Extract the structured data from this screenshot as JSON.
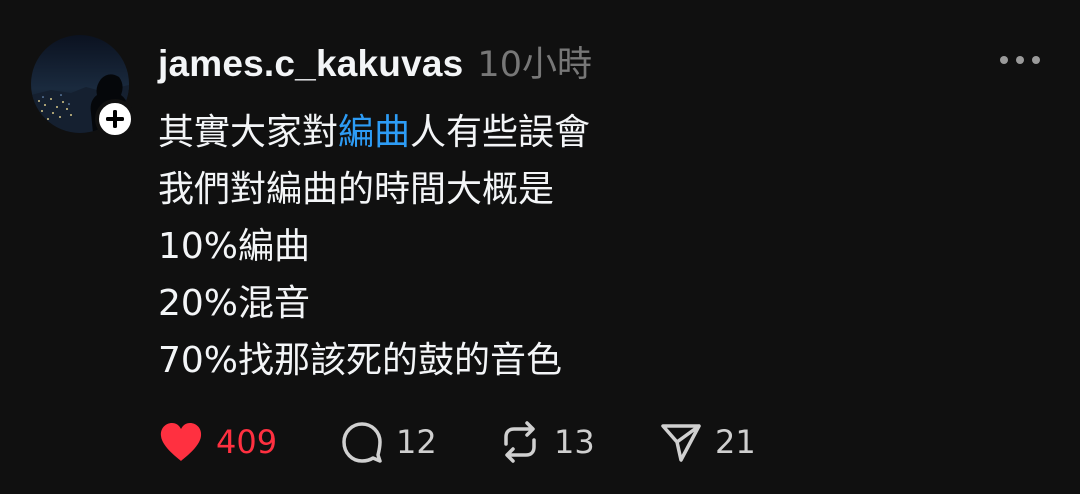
{
  "post": {
    "username": "james.c_kakuvas",
    "timestamp": "10小時",
    "body": {
      "line1_before": "其實大家對",
      "line1_hashtag": "編曲",
      "line1_after": "人有些誤會",
      "line2": "我們對編曲的時間大概是",
      "line3": "10%編曲",
      "line4": "20%混音",
      "line5": "70%找那該死的鼓的音色"
    },
    "actions": {
      "likes": "409",
      "comments": "12",
      "reposts": "13",
      "shares": "21"
    }
  },
  "colors": {
    "background": "#101010",
    "text": "#f3f5f7",
    "muted": "#777777",
    "hashtag": "#2d9cf5",
    "like": "#ff3040"
  },
  "icons": {
    "avatar": "avatar-night-city",
    "follow": "plus-icon",
    "more": "more-horizontal-icon",
    "like": "heart-filled-icon",
    "comment": "comment-bubble-icon",
    "repost": "repost-icon",
    "share": "send-icon"
  }
}
